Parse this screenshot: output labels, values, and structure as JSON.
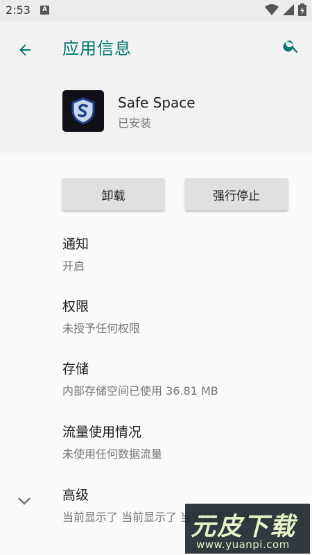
{
  "status_bar": {
    "time": "2:53",
    "notification_badge": "A",
    "icons": [
      "wifi-icon",
      "cell-signal-icon",
      "battery-icon"
    ]
  },
  "header": {
    "title": "应用信息",
    "back_icon": "arrow-left-icon",
    "search_icon": "search-icon",
    "accent_color": "#00796b"
  },
  "app": {
    "name": "Safe Space",
    "status": "已安装",
    "icon": "shield-s-icon"
  },
  "actions": {
    "uninstall_label": "卸载",
    "force_stop_label": "强行停止"
  },
  "prefs": [
    {
      "title": "通知",
      "summary": "开启"
    },
    {
      "title": "权限",
      "summary": "未授予任何权限"
    },
    {
      "title": "存储",
      "summary": "内部存储空间已使用 36.81 MB"
    },
    {
      "title": "流量使用情况",
      "summary": "未使用任何数据流量"
    },
    {
      "title": "高级",
      "summary": "当前显示了 当前显示了 当前显示了 电池"
    }
  ],
  "expand_icon": "chevron-down-icon",
  "watermark": {
    "text": "元皮下载",
    "url": "www.yuanpi.com"
  }
}
